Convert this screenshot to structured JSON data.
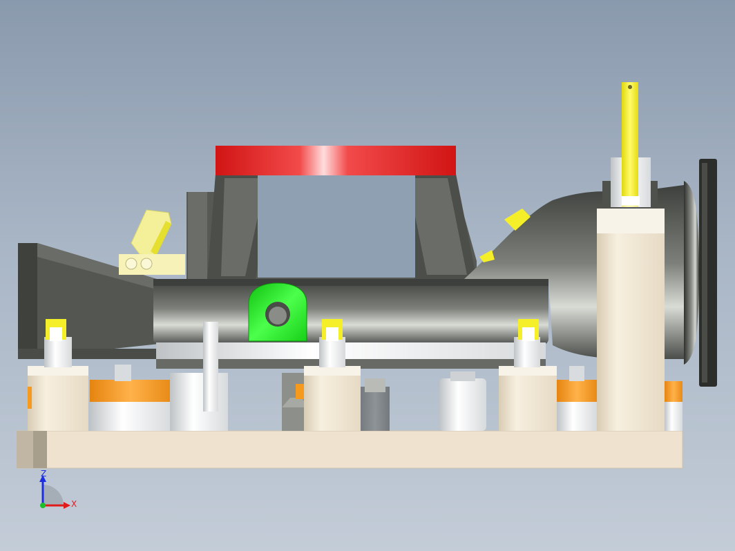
{
  "viewport": {
    "background_top": "#8a9aad",
    "background_bottom": "#c3ccd7"
  },
  "triad": {
    "z_label": "Z",
    "x_label": "X",
    "z_color": "#1b2fe0",
    "x_color": "#e01b1b",
    "y_color": "#1bbf2a"
  },
  "colors": {
    "base_plate": "#efe3d0",
    "fixture_red": "#e51a1a",
    "casting_gray": "#5d5f5b",
    "locator_green": "#22e022",
    "clamp_yellow": "#f5ef2a",
    "pad_orange": "#f59a1c",
    "cylinder_cream": "#ece4d2"
  }
}
